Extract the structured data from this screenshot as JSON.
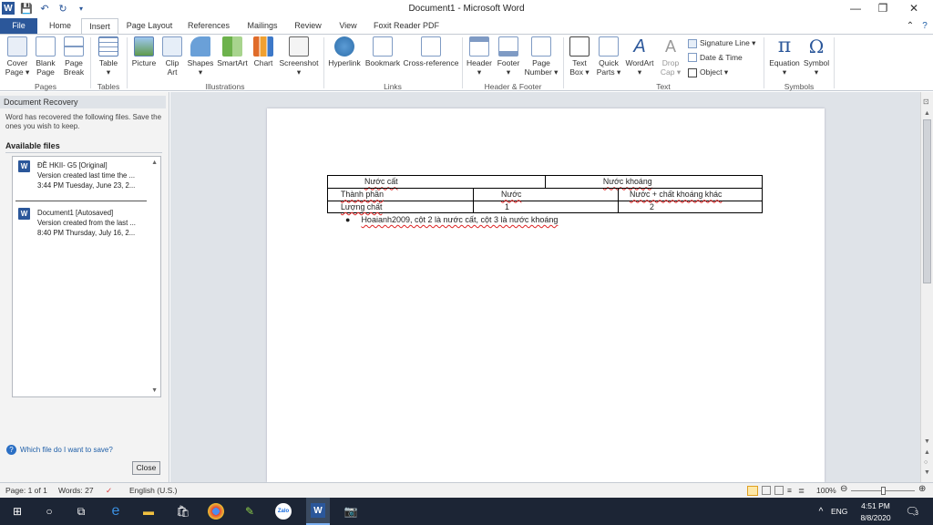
{
  "window": {
    "title": "Document1 - Microsoft Word",
    "app_icon": "W"
  },
  "tabs": [
    "File",
    "Home",
    "Insert",
    "Page Layout",
    "References",
    "Mailings",
    "Review",
    "View",
    "Foxit Reader PDF"
  ],
  "ribbon": {
    "pages": [
      "Cover\nPage ▾",
      "Blank\nPage",
      "Page\nBreak"
    ],
    "pages_group": "Pages",
    "table": "Table\n▾",
    "tables_group": "Tables",
    "illustrations": [
      "Picture",
      "Clip\nArt",
      "Shapes\n▾",
      "SmartArt",
      "Chart",
      "Screenshot\n▾"
    ],
    "illustrations_group": "Illustrations",
    "links": [
      "Hyperlink",
      "Bookmark",
      "Cross-reference"
    ],
    "links_group": "Links",
    "headerfooter": [
      "Header\n▾",
      "Footer\n▾",
      "Page\nNumber ▾"
    ],
    "headerfooter_group": "Header & Footer",
    "text": [
      "Text\nBox ▾",
      "Quick\nParts ▾",
      "WordArt\n▾",
      "Drop\nCap ▾"
    ],
    "text_small": [
      "Signature Line ▾",
      "Date & Time",
      "Object ▾"
    ],
    "text_group": "Text",
    "symbols": [
      "Equation\n▾",
      "Symbol\n▾"
    ],
    "equation_glyph": "π",
    "symbol_glyph": "Ω",
    "symbols_group": "Symbols"
  },
  "recovery": {
    "title": "Document Recovery",
    "description": "Word has recovered the following files.  Save the ones you wish to keep.",
    "available": "Available files",
    "files": [
      {
        "name": "ĐỀ HKII- G5  [Original]",
        "line2": "Version created last time the ...",
        "line3": "3:44 PM Tuesday, June 23, 2..."
      },
      {
        "name": "Document1  [Autosaved]",
        "line2": "Version created from the last ...",
        "line3": "8:40 PM Thursday, July 16, 2..."
      }
    ],
    "help": "Which file do I want to save?",
    "close": "Close"
  },
  "document": {
    "row1": [
      "Nước cất",
      "Nước khoáng"
    ],
    "row2": [
      "Thành phần",
      "Nước",
      "Nước  + chất khoáng khác"
    ],
    "row3": [
      "Lượng chất",
      "1",
      "2"
    ],
    "bullet": "Hoaianh2009, cột 2 là nước cất, cột 3 là nước khoáng"
  },
  "status": {
    "page": "Page: 1 of 1",
    "words": "Words: 27",
    "language": "English (U.S.)",
    "zoom": "100%"
  },
  "taskbar": {
    "lang": "ENG",
    "time": "4:51 PM",
    "date": "8/8/2020",
    "notifications": "3"
  }
}
